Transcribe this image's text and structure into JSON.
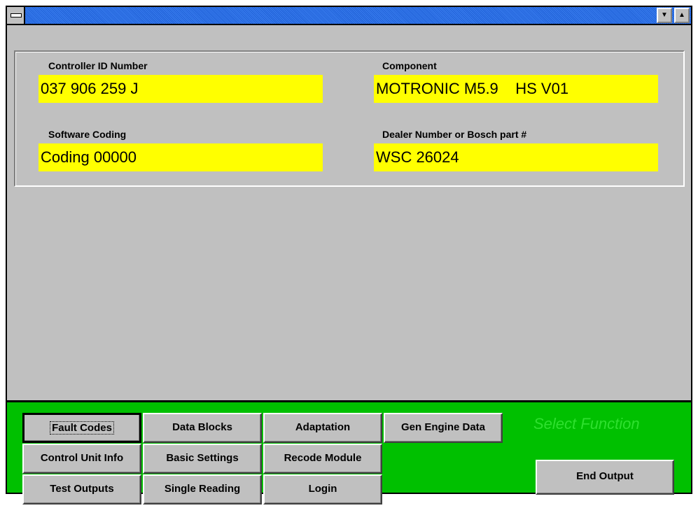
{
  "titlebar": {
    "system_menu_icon": "window-menu-icon",
    "min_icon": "▼",
    "max_icon": "▲"
  },
  "fields": {
    "controller_id": {
      "label": "Controller ID Number",
      "value": "037 906 259 J"
    },
    "component": {
      "label": "Component",
      "value": "MOTRONIC M5.9    HS V01"
    },
    "software_coding": {
      "label": "Software Coding",
      "value": "Coding 00000"
    },
    "dealer_number": {
      "label": "Dealer Number or Bosch part #",
      "value": "WSC 26024"
    }
  },
  "functions": {
    "status": "Select Function",
    "fault_codes": "Fault Codes",
    "data_blocks": "Data Blocks",
    "adaptation": "Adaptation",
    "gen_engine_data": "Gen Engine Data",
    "control_unit_info": "Control Unit Info",
    "basic_settings": "Basic Settings",
    "recode_module": "Recode Module",
    "test_outputs": "Test Outputs",
    "single_reading": "Single Reading",
    "login": "Login",
    "end_output": "End Output"
  },
  "colors": {
    "field_bg": "#ffff00",
    "panel_bg": "#c0c0c0",
    "function_bg": "#00c000",
    "titlebar": "#2a6fe8"
  }
}
